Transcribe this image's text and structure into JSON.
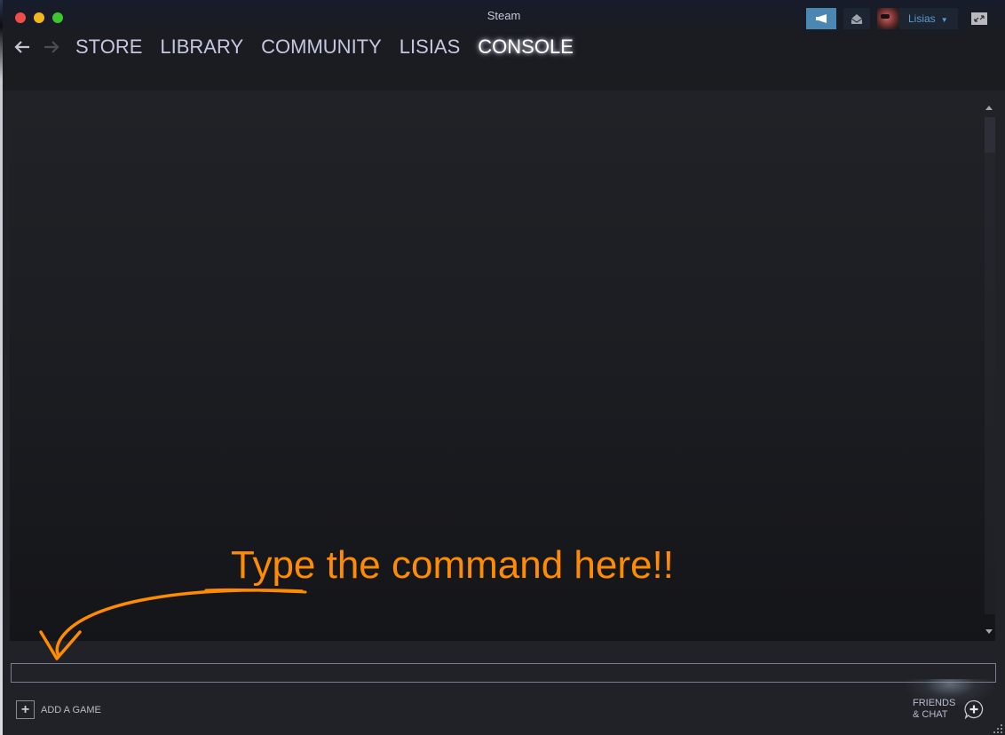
{
  "window": {
    "title": "Steam"
  },
  "nav": {
    "back_icon": "arrow-left-icon",
    "forward_icon": "arrow-right-icon",
    "items": [
      {
        "label": "STORE",
        "active": false
      },
      {
        "label": "LIBRARY",
        "active": false
      },
      {
        "label": "COMMUNITY",
        "active": false
      },
      {
        "label": "LISIAS",
        "active": false
      },
      {
        "label": "CONSOLE",
        "active": true
      }
    ]
  },
  "account": {
    "announcements_icon": "megaphone-icon",
    "inbox_icon": "envelope-icon",
    "username": "Lisias",
    "caret_icon": "chevron-down-icon",
    "fullscreen_icon": "expand-icon"
  },
  "console": {
    "output": "",
    "input_value": "",
    "input_placeholder": ""
  },
  "footer": {
    "add_game_label": "ADD A GAME",
    "add_game_icon": "plus-icon",
    "friends_label_line1": "FRIENDS",
    "friends_label_line2": "& CHAT",
    "friends_icon": "chat-plus-icon"
  },
  "annotation": {
    "text": "Type the command here!!",
    "color": "#ff8c00"
  },
  "colors": {
    "accent_blue": "#4b87b3",
    "username_blue": "#5a9dd0",
    "nav_text": "#c3c8e0",
    "background": "#202227"
  }
}
